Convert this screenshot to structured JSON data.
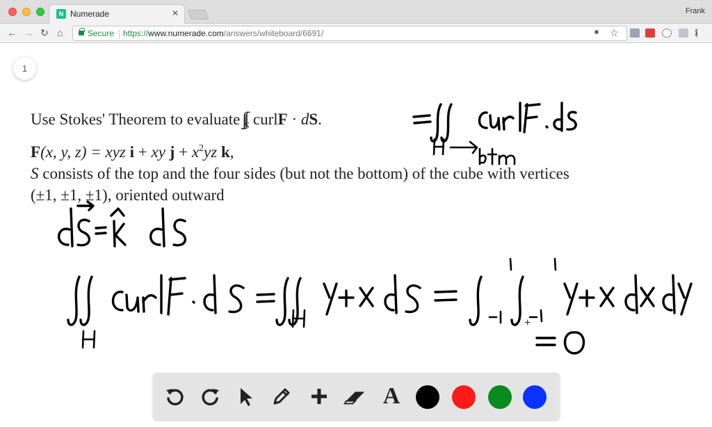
{
  "browser": {
    "tab_title": "Numerade",
    "favicon_letter": "N",
    "tab_close": "✕",
    "profile_name": "Frank",
    "secure_label": "Secure",
    "url_scheme": "https://",
    "url_host": "www.numerade.com",
    "url_path": "/answers/whiteboard/6691/",
    "nav_back": "←",
    "nav_forward": "→",
    "nav_reload": "↻",
    "nav_home": "⌂",
    "bookmark_star": "☆",
    "camera_icon": "■",
    "icons": [
      "back-icon",
      "forward-icon",
      "reload-icon",
      "home-icon",
      "lock-icon",
      "camera-icon",
      "star-icon",
      "extension-icon",
      "menu-icon"
    ]
  },
  "whiteboard": {
    "page_number": "1",
    "problem": {
      "line1_prefix": "Use Stokes' Theorem to evaluate ",
      "line1_sub": "S",
      "line1_curl": " curl",
      "line1_F": "F",
      "line1_dot": " · ",
      "line1_d": "d",
      "line1_S": "S",
      "line1_end": ".",
      "line2_F": "F",
      "line2_args": "(x, y, z) = xyz ",
      "line2_i": "i",
      "line2_plus1": " + ",
      "line2_xy": "xy ",
      "line2_j": "j",
      "line2_plus2": " + ",
      "line2_x": "x",
      "line2_exp": "2",
      "line2_yz": "yz ",
      "line2_k": "k",
      "line2_end": ",",
      "line3_S": "S",
      "line3_rest": " consists of the top and the four sides (but not the bottom) of the cube with vertices",
      "line4": "(±1, ±1, ±1), oriented outward"
    }
  },
  "tools": {
    "undo_icon": "undo-icon",
    "redo_icon": "redo-icon",
    "select_icon": "pointer-icon",
    "pen_icon": "pencil-icon",
    "add_icon": "plus-icon",
    "eraser_icon": "eraser-icon",
    "text_label": "A",
    "colors": [
      "#000000",
      "#ff1a1a",
      "#0a8a1f",
      "#0a33ff"
    ]
  }
}
